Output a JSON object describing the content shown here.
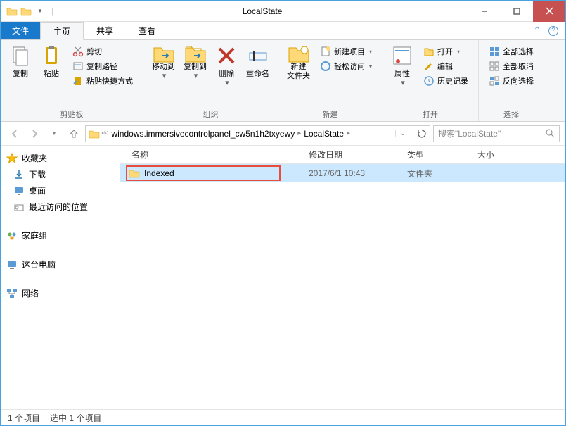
{
  "window": {
    "title": "LocalState"
  },
  "tabs": {
    "file": "文件",
    "items": [
      "主页",
      "共享",
      "查看"
    ],
    "active": 0
  },
  "ribbon": {
    "clipboard": {
      "label": "剪贴板",
      "copy": "复制",
      "paste": "粘贴",
      "cut": "剪切",
      "copypath": "复制路径",
      "pasteshortcut": "粘贴快捷方式"
    },
    "organize": {
      "label": "组织",
      "moveto": "移动到",
      "copyto": "复制到",
      "delete": "删除",
      "rename": "重命名"
    },
    "new": {
      "label": "新建",
      "newfolder": "新建\n文件夹",
      "newitem": "新建项目",
      "easyaccess": "轻松访问"
    },
    "open": {
      "label": "打开",
      "properties": "属性",
      "open": "打开",
      "edit": "编辑",
      "history": "历史记录"
    },
    "select": {
      "label": "选择",
      "selectall": "全部选择",
      "selectnone": "全部取消",
      "invert": "反向选择"
    }
  },
  "breadcrumb": {
    "items": [
      "windows.immersivecontrolpanel_cw5n1h2txyewy",
      "LocalState"
    ]
  },
  "search": {
    "placeholder": "搜索\"LocalState\""
  },
  "sidebar": {
    "favorites": {
      "label": "收藏夹",
      "items": [
        "下载",
        "桌面",
        "最近访问的位置"
      ]
    },
    "homegroup": "家庭组",
    "thispc": "这台电脑",
    "network": "网络"
  },
  "columns": {
    "name": "名称",
    "date": "修改日期",
    "type": "类型",
    "size": "大小"
  },
  "files": [
    {
      "name": "Indexed",
      "date": "2017/6/1 10:43",
      "type": "文件夹",
      "selected": true,
      "highlighted": true
    }
  ],
  "status": {
    "total": "1 个项目",
    "selected": "选中 1 个项目"
  }
}
